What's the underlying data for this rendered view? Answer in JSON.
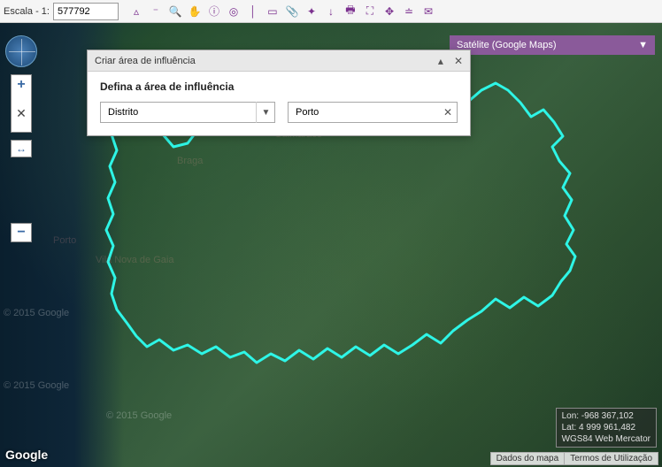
{
  "toolbar": {
    "scale_label": "Escala - 1:",
    "scale_value": "577792",
    "icons": [
      "highlight",
      "minus",
      "search",
      "hand",
      "info",
      "circle",
      "line",
      "note",
      "attach",
      "point",
      "down",
      "print",
      "extent",
      "pan",
      "measure",
      "mail"
    ]
  },
  "nav": {
    "zoom_in": "+",
    "reset": "✕",
    "pan": "↔",
    "zoom_out": "−"
  },
  "basemap": {
    "label": "Satélite (Google Maps)",
    "arrow": "▼"
  },
  "dialog": {
    "title": "Criar área de influência",
    "collapse": "▴",
    "close": "✕",
    "subtitle": "Defina a área de influência",
    "select_value": "Distrito",
    "select_arrow": "▼",
    "input_value": "Porto",
    "input_clear": "✕"
  },
  "watermarks": [
    "Guimarães",
    "Braga",
    "Porto",
    "Vila Nova de Gaia",
    "© 2015 Google",
    "© 2015 Google",
    "© 2015 Google"
  ],
  "footer": {
    "google": "Google",
    "coord_lon": "Lon: -968 367,102",
    "coord_lat": "Lat: 4 999 961,482",
    "coord_srs": "WGS84 Web Mercator",
    "links": [
      "Dados do mapa",
      "Termos de Utilização"
    ]
  }
}
